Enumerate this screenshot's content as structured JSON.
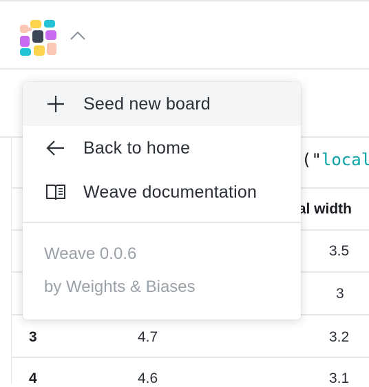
{
  "header": {
    "logo_icon": "weave-logo-icon",
    "menu_toggle_icon": "chevron-up-icon"
  },
  "table": {
    "code_prefix": "(\"",
    "code_string": "local",
    "column_header": "Sepal width",
    "column_header_visible": "pal width",
    "rows": [
      {
        "index": "",
        "col1": "",
        "col2": "3.5"
      },
      {
        "index": "",
        "col1": "",
        "col2": "3"
      },
      {
        "index": "3",
        "col1": "4.7",
        "col2": "3.2"
      },
      {
        "index": "4",
        "col1": "4.6",
        "col2": "3.1"
      }
    ]
  },
  "menu": {
    "items": [
      {
        "label": "Seed new board",
        "icon": "plus-icon"
      },
      {
        "label": "Back to home",
        "icon": "arrow-left-icon"
      },
      {
        "label": "Weave documentation",
        "icon": "book-icon"
      }
    ],
    "version": "Weave 0.0.6",
    "credit": "by Weights & Biases"
  },
  "colors": {
    "logo": [
      "#f9c7b4",
      "#fbd34d",
      "#22c4d6",
      "#c86cf0",
      "#3d4654",
      "#8ea3f7"
    ],
    "code_string": "#0aa3a6",
    "muted_text": "#9ba1a8"
  }
}
